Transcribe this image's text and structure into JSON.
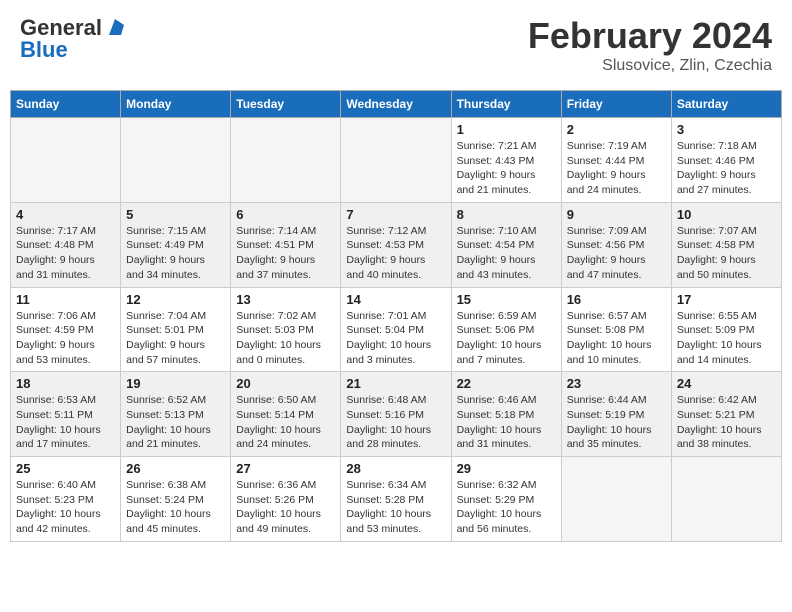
{
  "header": {
    "logo_line1": "General",
    "logo_line2": "Blue",
    "month": "February 2024",
    "location": "Slusovice, Zlin, Czechia"
  },
  "days_of_week": [
    "Sunday",
    "Monday",
    "Tuesday",
    "Wednesday",
    "Thursday",
    "Friday",
    "Saturday"
  ],
  "weeks": [
    [
      {
        "num": "",
        "empty": true
      },
      {
        "num": "",
        "empty": true
      },
      {
        "num": "",
        "empty": true
      },
      {
        "num": "",
        "empty": true
      },
      {
        "num": "1",
        "sunrise": "7:21 AM",
        "sunset": "4:43 PM",
        "daylight": "9 hours and 21 minutes."
      },
      {
        "num": "2",
        "sunrise": "7:19 AM",
        "sunset": "4:44 PM",
        "daylight": "9 hours and 24 minutes."
      },
      {
        "num": "3",
        "sunrise": "7:18 AM",
        "sunset": "4:46 PM",
        "daylight": "9 hours and 27 minutes."
      }
    ],
    [
      {
        "num": "4",
        "sunrise": "7:17 AM",
        "sunset": "4:48 PM",
        "daylight": "9 hours and 31 minutes."
      },
      {
        "num": "5",
        "sunrise": "7:15 AM",
        "sunset": "4:49 PM",
        "daylight": "9 hours and 34 minutes."
      },
      {
        "num": "6",
        "sunrise": "7:14 AM",
        "sunset": "4:51 PM",
        "daylight": "9 hours and 37 minutes."
      },
      {
        "num": "7",
        "sunrise": "7:12 AM",
        "sunset": "4:53 PM",
        "daylight": "9 hours and 40 minutes."
      },
      {
        "num": "8",
        "sunrise": "7:10 AM",
        "sunset": "4:54 PM",
        "daylight": "9 hours and 43 minutes."
      },
      {
        "num": "9",
        "sunrise": "7:09 AM",
        "sunset": "4:56 PM",
        "daylight": "9 hours and 47 minutes."
      },
      {
        "num": "10",
        "sunrise": "7:07 AM",
        "sunset": "4:58 PM",
        "daylight": "9 hours and 50 minutes."
      }
    ],
    [
      {
        "num": "11",
        "sunrise": "7:06 AM",
        "sunset": "4:59 PM",
        "daylight": "9 hours and 53 minutes."
      },
      {
        "num": "12",
        "sunrise": "7:04 AM",
        "sunset": "5:01 PM",
        "daylight": "9 hours and 57 minutes."
      },
      {
        "num": "13",
        "sunrise": "7:02 AM",
        "sunset": "5:03 PM",
        "daylight": "10 hours and 0 minutes."
      },
      {
        "num": "14",
        "sunrise": "7:01 AM",
        "sunset": "5:04 PM",
        "daylight": "10 hours and 3 minutes."
      },
      {
        "num": "15",
        "sunrise": "6:59 AM",
        "sunset": "5:06 PM",
        "daylight": "10 hours and 7 minutes."
      },
      {
        "num": "16",
        "sunrise": "6:57 AM",
        "sunset": "5:08 PM",
        "daylight": "10 hours and 10 minutes."
      },
      {
        "num": "17",
        "sunrise": "6:55 AM",
        "sunset": "5:09 PM",
        "daylight": "10 hours and 14 minutes."
      }
    ],
    [
      {
        "num": "18",
        "sunrise": "6:53 AM",
        "sunset": "5:11 PM",
        "daylight": "10 hours and 17 minutes."
      },
      {
        "num": "19",
        "sunrise": "6:52 AM",
        "sunset": "5:13 PM",
        "daylight": "10 hours and 21 minutes."
      },
      {
        "num": "20",
        "sunrise": "6:50 AM",
        "sunset": "5:14 PM",
        "daylight": "10 hours and 24 minutes."
      },
      {
        "num": "21",
        "sunrise": "6:48 AM",
        "sunset": "5:16 PM",
        "daylight": "10 hours and 28 minutes."
      },
      {
        "num": "22",
        "sunrise": "6:46 AM",
        "sunset": "5:18 PM",
        "daylight": "10 hours and 31 minutes."
      },
      {
        "num": "23",
        "sunrise": "6:44 AM",
        "sunset": "5:19 PM",
        "daylight": "10 hours and 35 minutes."
      },
      {
        "num": "24",
        "sunrise": "6:42 AM",
        "sunset": "5:21 PM",
        "daylight": "10 hours and 38 minutes."
      }
    ],
    [
      {
        "num": "25",
        "sunrise": "6:40 AM",
        "sunset": "5:23 PM",
        "daylight": "10 hours and 42 minutes."
      },
      {
        "num": "26",
        "sunrise": "6:38 AM",
        "sunset": "5:24 PM",
        "daylight": "10 hours and 45 minutes."
      },
      {
        "num": "27",
        "sunrise": "6:36 AM",
        "sunset": "5:26 PM",
        "daylight": "10 hours and 49 minutes."
      },
      {
        "num": "28",
        "sunrise": "6:34 AM",
        "sunset": "5:28 PM",
        "daylight": "10 hours and 53 minutes."
      },
      {
        "num": "29",
        "sunrise": "6:32 AM",
        "sunset": "5:29 PM",
        "daylight": "10 hours and 56 minutes."
      },
      {
        "num": "",
        "empty": true
      },
      {
        "num": "",
        "empty": true
      }
    ]
  ]
}
